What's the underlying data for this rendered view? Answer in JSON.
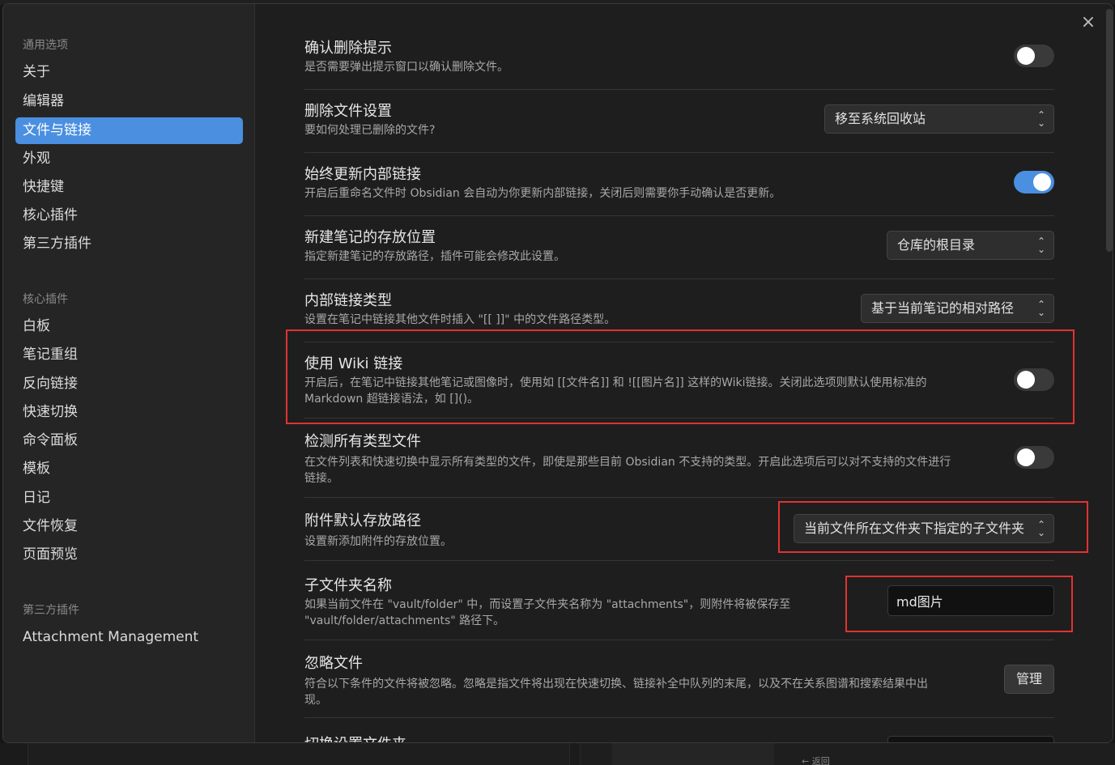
{
  "background": {
    "back_link": "← 返回"
  },
  "modal": {
    "close_symbol": "×"
  },
  "sidebar": {
    "groups": [
      {
        "heading": "通用选项",
        "items": [
          "关于",
          "编辑器",
          "文件与链接",
          "外观",
          "快捷键",
          "核心插件",
          "第三方插件"
        ]
      },
      {
        "heading": "核心插件",
        "items": [
          "白板",
          "笔记重组",
          "反向链接",
          "快速切换",
          "命令面板",
          "模板",
          "日记",
          "文件恢复",
          "页面预览"
        ]
      },
      {
        "heading": "第三方插件",
        "items": [
          "Attachment Management"
        ]
      }
    ],
    "active_item": "文件与链接",
    "accent_color": "#4a8fe0"
  },
  "settings": {
    "confirm_delete": {
      "title": "确认删除提示",
      "desc": "是否需要弹出提示窗口以确认删除文件。",
      "enabled": false
    },
    "delete_files": {
      "title": "删除文件设置",
      "desc": "要如何处理已删除的文件?",
      "value": "移至系统回收站"
    },
    "update_links": {
      "title": "始终更新内部链接",
      "desc": "开启后重命名文件时 Obsidian 会自动为你更新内部链接，关闭后则需要你手动确认是否更新。",
      "enabled": true
    },
    "new_note_location": {
      "title": "新建笔记的存放位置",
      "desc": "指定新建笔记的存放路径，插件可能会修改此设置。",
      "value": "仓库的根目录"
    },
    "link_format": {
      "title": "内部链接类型",
      "desc": "设置在笔记中链接其他文件时插入 \"[[ ]]\" 中的文件路径类型。",
      "value": "基于当前笔记的相对路径"
    },
    "wiki_links": {
      "title": "使用 Wiki 链接",
      "desc_line1": "开启后，在笔记中链接其他笔记或图像时，使用如 [[文件名]] 和 ![[图片名]] 这样的Wiki链接。关闭此选项则默认使用标准的",
      "desc_line2": "Markdown 超链接语法，如 []()。",
      "enabled": false
    },
    "detect_all": {
      "title": "检测所有类型文件",
      "desc_line1": "在文件列表和快速切换中显示所有类型的文件，即使是那些目前 Obsidian 不支持的类型。开启此选项后可以对不支持的文件进行",
      "desc_line2": "链接。",
      "enabled": false
    },
    "attachment_folder": {
      "title": "附件默认存放路径",
      "desc": "设置新添加附件的存放位置。",
      "value": "当前文件所在文件夹下指定的子文件夹"
    },
    "subfolder_name": {
      "title": "子文件夹名称",
      "desc_line1": "如果当前文件在 \"vault/folder\" 中，而设置子文件夹名称为 \"attachments\"，则附件将被保存至",
      "desc_line2": "\"vault/folder/attachments\" 路径下。",
      "value": "md图片"
    },
    "ignore_files": {
      "title": "忽略文件",
      "desc_line1": "符合以下条件的文件将被忽略。忽略是指文件将出现在快速切换、链接补全中队列的末尾，以及不在关系图谱和搜索结果中出",
      "desc_line2": "现。",
      "button": "管理"
    },
    "switch_config": {
      "title": "切换设置文件夹"
    }
  },
  "highlight_color": "#e23232"
}
